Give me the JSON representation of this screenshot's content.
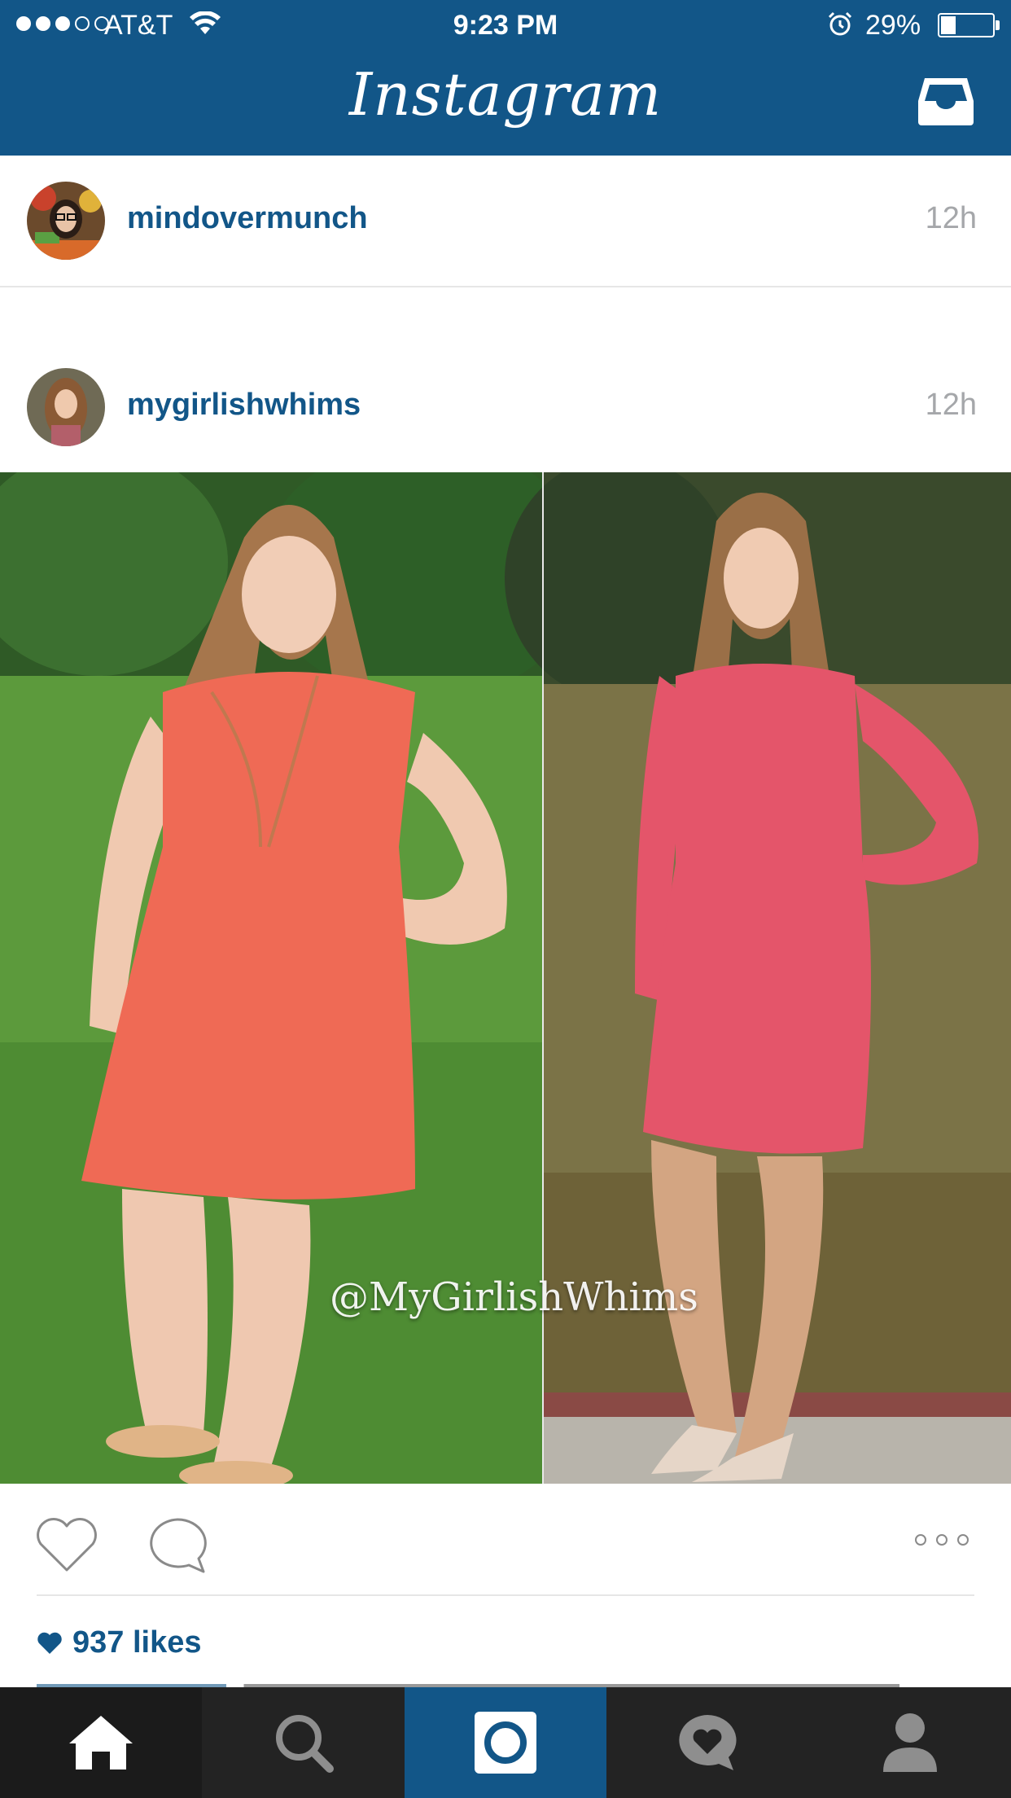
{
  "status_bar": {
    "carrier": "AT&T",
    "time": "9:23 PM",
    "battery": "29%",
    "battery_level": 0.29,
    "signal_bars": 3,
    "signal_total": 5
  },
  "nav": {
    "title": "Instagram",
    "inbox_icon": "inbox-icon"
  },
  "posts": [
    {
      "username": "mindovermunch",
      "time": "12h"
    },
    {
      "username": "mygirlishwhims",
      "time": "12h"
    }
  ],
  "photo": {
    "watermark": "@MyGirlishWhims"
  },
  "actions": {
    "like_icon": "heart-outline-icon",
    "comment_icon": "comment-icon",
    "more_icon": "more-options-icon"
  },
  "likes": {
    "text": "937 likes"
  },
  "tabbar": {
    "items": [
      "home-icon",
      "search-icon",
      "camera-icon",
      "activity-heart-icon",
      "profile-icon"
    ],
    "active": "home"
  },
  "colors": {
    "brand": "#125688",
    "tabbar": "#232323",
    "timestamp": "#a5a7aa"
  }
}
